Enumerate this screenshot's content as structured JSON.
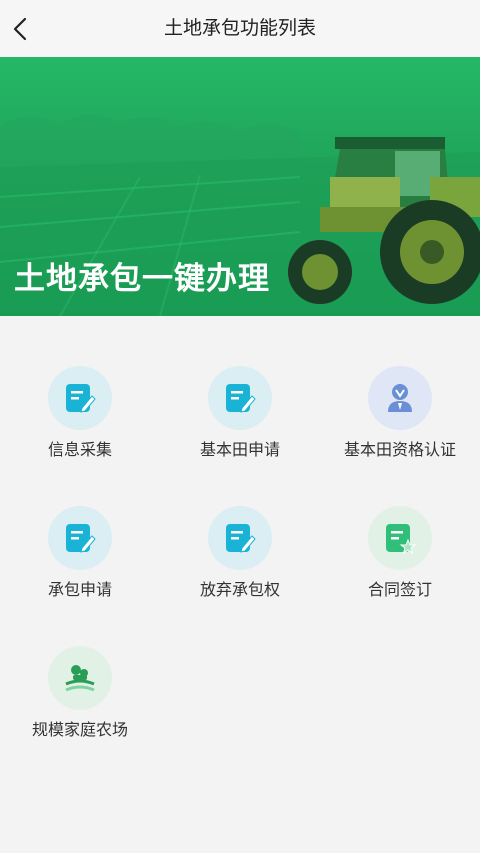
{
  "header": {
    "title": "土地承包功能列表",
    "back_icon": "chevron-left-icon"
  },
  "banner": {
    "headline": "土地承包一键办理"
  },
  "colors": {
    "brand_green": "#1fa45a",
    "icon_teal": "#19b3d6",
    "icon_green": "#2fbf7a"
  },
  "menu": {
    "items": [
      {
        "label": "信息采集",
        "icon": "edit-document-icon"
      },
      {
        "label": "基本田申请",
        "icon": "edit-document-icon"
      },
      {
        "label": "基本田资格认证",
        "icon": "verified-user-icon"
      },
      {
        "label": "承包申请",
        "icon": "edit-document-icon"
      },
      {
        "label": "放弃承包权",
        "icon": "edit-document-icon"
      },
      {
        "label": "合同签订",
        "icon": "contract-star-icon"
      },
      {
        "label": "规模家庭农场",
        "icon": "family-farm-icon"
      }
    ]
  }
}
